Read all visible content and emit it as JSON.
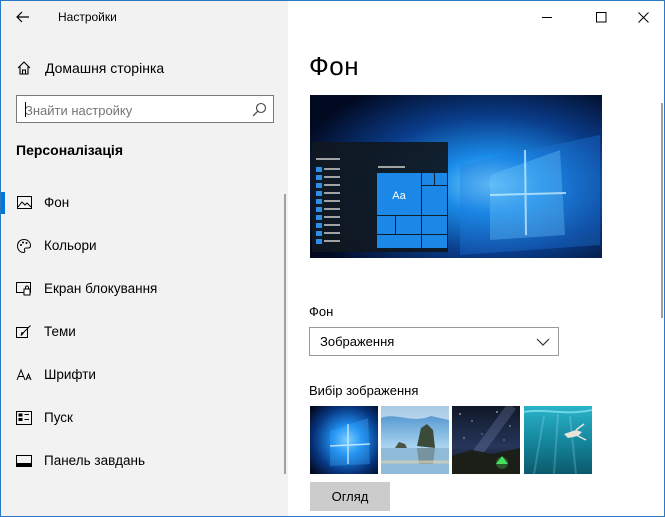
{
  "app": {
    "title": "Настройки"
  },
  "left": {
    "home_label": "Домашня сторінка",
    "search": {
      "placeholder": "Знайти настройку"
    },
    "section_title": "Персоналізація",
    "nav": [
      {
        "label": "Фон",
        "icon": "image-icon",
        "active": true
      },
      {
        "label": "Кольори",
        "icon": "palette-icon",
        "active": false
      },
      {
        "label": "Екран блокування",
        "icon": "lock-screen-icon",
        "active": false
      },
      {
        "label": "Теми",
        "icon": "themes-icon",
        "active": false
      },
      {
        "label": "Шрифти",
        "icon": "font-icon",
        "active": false
      },
      {
        "label": "Пуск",
        "icon": "start-icon",
        "active": false
      },
      {
        "label": "Панель завдань",
        "icon": "taskbar-icon",
        "active": false
      }
    ]
  },
  "main": {
    "title": "Фон",
    "preview_tile_text": "Aa",
    "background_label": "Фон",
    "background_value": "Зображення",
    "choose_label": "Вибір зображення",
    "browse_label": "Огляд"
  },
  "colors": {
    "accent": "#0078d7",
    "left_bg": "#f2f2f2",
    "button_bg": "#cccccc"
  }
}
